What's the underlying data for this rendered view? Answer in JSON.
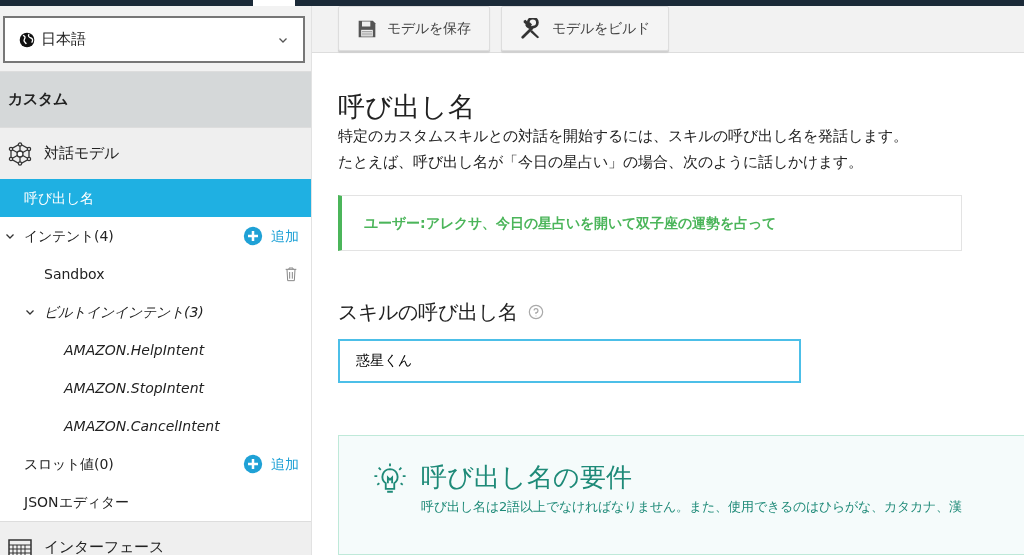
{
  "sidebar": {
    "language": {
      "value": "日本語"
    },
    "section_title": "カスタム",
    "items": [
      {
        "kind": "heading",
        "label": "対話モデル",
        "selected": false
      },
      {
        "kind": "link",
        "label": "呼び出し名",
        "selected": true
      },
      {
        "kind": "folder",
        "label": "インテント(4)",
        "expanded": true,
        "action": "追加",
        "selected": false,
        "children": [
          {
            "kind": "custom",
            "label": "Sandbox",
            "selected": false
          },
          {
            "kind": "folder",
            "label": "ビルトインインテント(3)",
            "italic": true,
            "expanded": true,
            "selected": false,
            "children": [
              {
                "kind": "builtin",
                "label": "AMAZON.HelpIntent",
                "selected": false
              },
              {
                "kind": "builtin",
                "label": "AMAZON.StopIntent",
                "selected": false
              },
              {
                "kind": "builtin",
                "label": "AMAZON.CancelIntent",
                "selected": false
              }
            ]
          }
        ]
      },
      {
        "kind": "link",
        "label": "スロット値(0)",
        "action": "追加",
        "selected": false
      },
      {
        "kind": "link",
        "label": "JSONエディター",
        "selected": false
      },
      {
        "kind": "heading",
        "label": "インターフェース",
        "selected": false
      }
    ]
  },
  "toolbar": {
    "buttons": [
      {
        "label": "モデルを保存"
      },
      {
        "label": "モデルをビルド"
      }
    ]
  },
  "content": {
    "title": "呼び出し名",
    "description": [
      "特定のカスタムスキルとの対話を開始するには、スキルの呼び出し名を発話します。",
      "たとえば、呼び出し名が「今日の星占い」の場合、次のように話しかけます。"
    ],
    "example": "ユーザー:アレクサ、今日の星占いを開いて双子座の運勢を占って",
    "field_label": "スキルの呼び出し名",
    "field_value": "惑星くん",
    "requirements": {
      "title": "呼び出し名の要件",
      "text": "呼び出し名は2語以上でなければなりません。また、使用できるのはひらがな、カタカナ、漢"
    }
  }
}
